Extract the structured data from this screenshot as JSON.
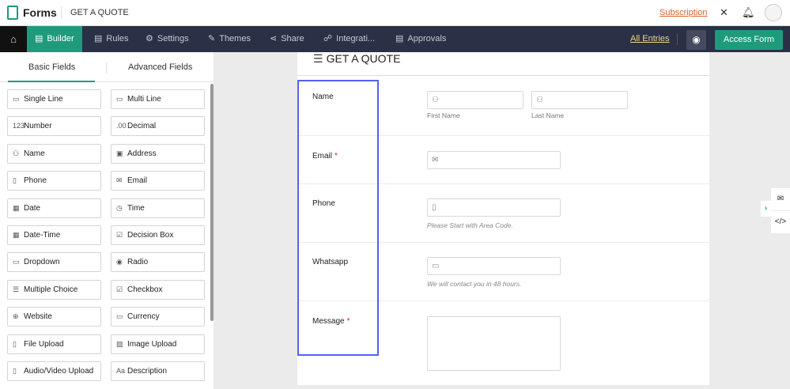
{
  "header": {
    "brand": "Forms",
    "form_title": "GET A QUOTE",
    "subscription": "Subscription",
    "icons": [
      "tools-icon",
      "bell-icon",
      "avatar"
    ]
  },
  "nav": {
    "items": [
      {
        "label": "Builder",
        "icon": "builder-icon"
      },
      {
        "label": "Rules",
        "icon": "rules-icon"
      },
      {
        "label": "Settings",
        "icon": "gear-icon"
      },
      {
        "label": "Themes",
        "icon": "themes-icon"
      },
      {
        "label": "Share",
        "icon": "share-icon"
      },
      {
        "label": "Integrati...",
        "icon": "integration-icon"
      },
      {
        "label": "Approvals",
        "icon": "approvals-icon"
      }
    ],
    "all_entries": "All Entries",
    "access_form": "Access Form",
    "active": "Builder"
  },
  "sidebar": {
    "tabs": [
      "Basic Fields",
      "Advanced Fields"
    ],
    "fields": [
      {
        "label": "Single Line",
        "icon": "▭"
      },
      {
        "label": "Multi Line",
        "icon": "▭"
      },
      {
        "label": "Number",
        "icon": "123"
      },
      {
        "label": "Decimal",
        "icon": ".00"
      },
      {
        "label": "Name",
        "icon": "⚇"
      },
      {
        "label": "Address",
        "icon": "▣"
      },
      {
        "label": "Phone",
        "icon": "▯"
      },
      {
        "label": "Email",
        "icon": "✉"
      },
      {
        "label": "Date",
        "icon": "▦"
      },
      {
        "label": "Time",
        "icon": "◷"
      },
      {
        "label": "Date-Time",
        "icon": "▦"
      },
      {
        "label": "Decision Box",
        "icon": "☑"
      },
      {
        "label": "Dropdown",
        "icon": "▭"
      },
      {
        "label": "Radio",
        "icon": "◉"
      },
      {
        "label": "Multiple Choice",
        "icon": "☰"
      },
      {
        "label": "Checkbox",
        "icon": "☑"
      },
      {
        "label": "Website",
        "icon": "⊕"
      },
      {
        "label": "Currency",
        "icon": "▭"
      },
      {
        "label": "File Upload",
        "icon": "▯"
      },
      {
        "label": "Image Upload",
        "icon": "▨"
      },
      {
        "label": "Audio/Video Upload",
        "icon": "▯"
      },
      {
        "label": "Description",
        "icon": "Aa"
      }
    ]
  },
  "form": {
    "title": "GET A QUOTE",
    "name": {
      "label": "Name",
      "first": "First Name",
      "last": "Last Name"
    },
    "email": {
      "label": "Email",
      "required": "*"
    },
    "phone": {
      "label": "Phone",
      "help": "Please Start with Area Code."
    },
    "whatsapp": {
      "label": "Whatsapp",
      "help": "We will contact you in 48 hours."
    },
    "message": {
      "label": "Message",
      "required": "*"
    }
  },
  "colors": {
    "accent": "#1f9b7c",
    "nav": "#2a3147",
    "selection": "#4f63f0",
    "required": "#e02020"
  }
}
